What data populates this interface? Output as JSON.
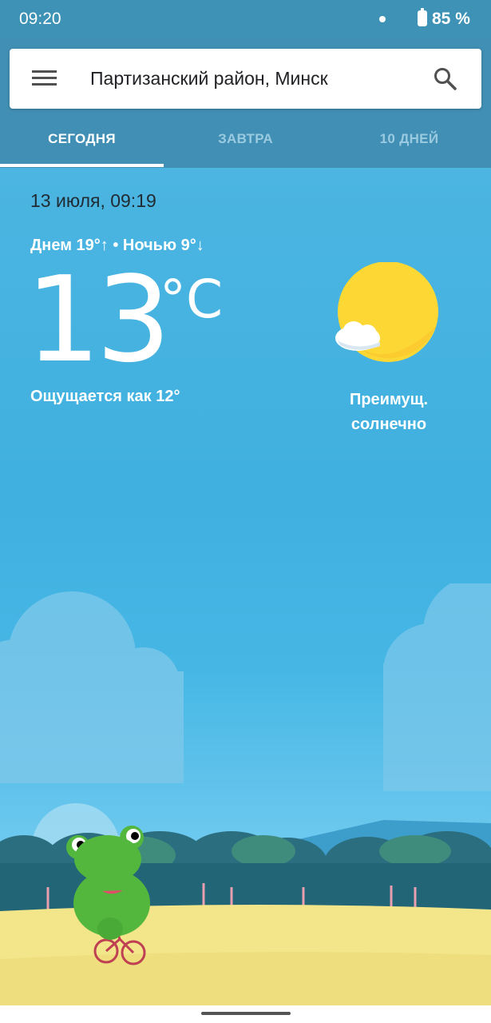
{
  "status_bar": {
    "time": "09:20",
    "battery": "85 %",
    "icons": [
      "notification-dot-icon",
      "battery-icon"
    ]
  },
  "search": {
    "location": "Партизанский район, Минск",
    "menu_icon": "menu-icon",
    "search_icon": "search-icon"
  },
  "tabs": [
    {
      "label": "СЕГОДНЯ",
      "active": true
    },
    {
      "label": "ЗАВТРА",
      "active": false
    },
    {
      "label": "10 ДНЕЙ",
      "active": false
    }
  ],
  "weather": {
    "date_time": "13 июля, 09:19",
    "day_night": "Днем 19°↑ • Ночью 9°↓",
    "temperature": "13",
    "unit": "°C",
    "feels_like": "Ощущается как 12°",
    "condition_line1": "Преимущ.",
    "condition_line2": "солнечно",
    "condition_icon": "mostly-sunny-icon"
  },
  "colors": {
    "status_bar": "#3D92B5",
    "header": "#418FB4",
    "sky": "#4CB5E1",
    "sun": "#FDD835",
    "grass": "#F2E58A"
  }
}
